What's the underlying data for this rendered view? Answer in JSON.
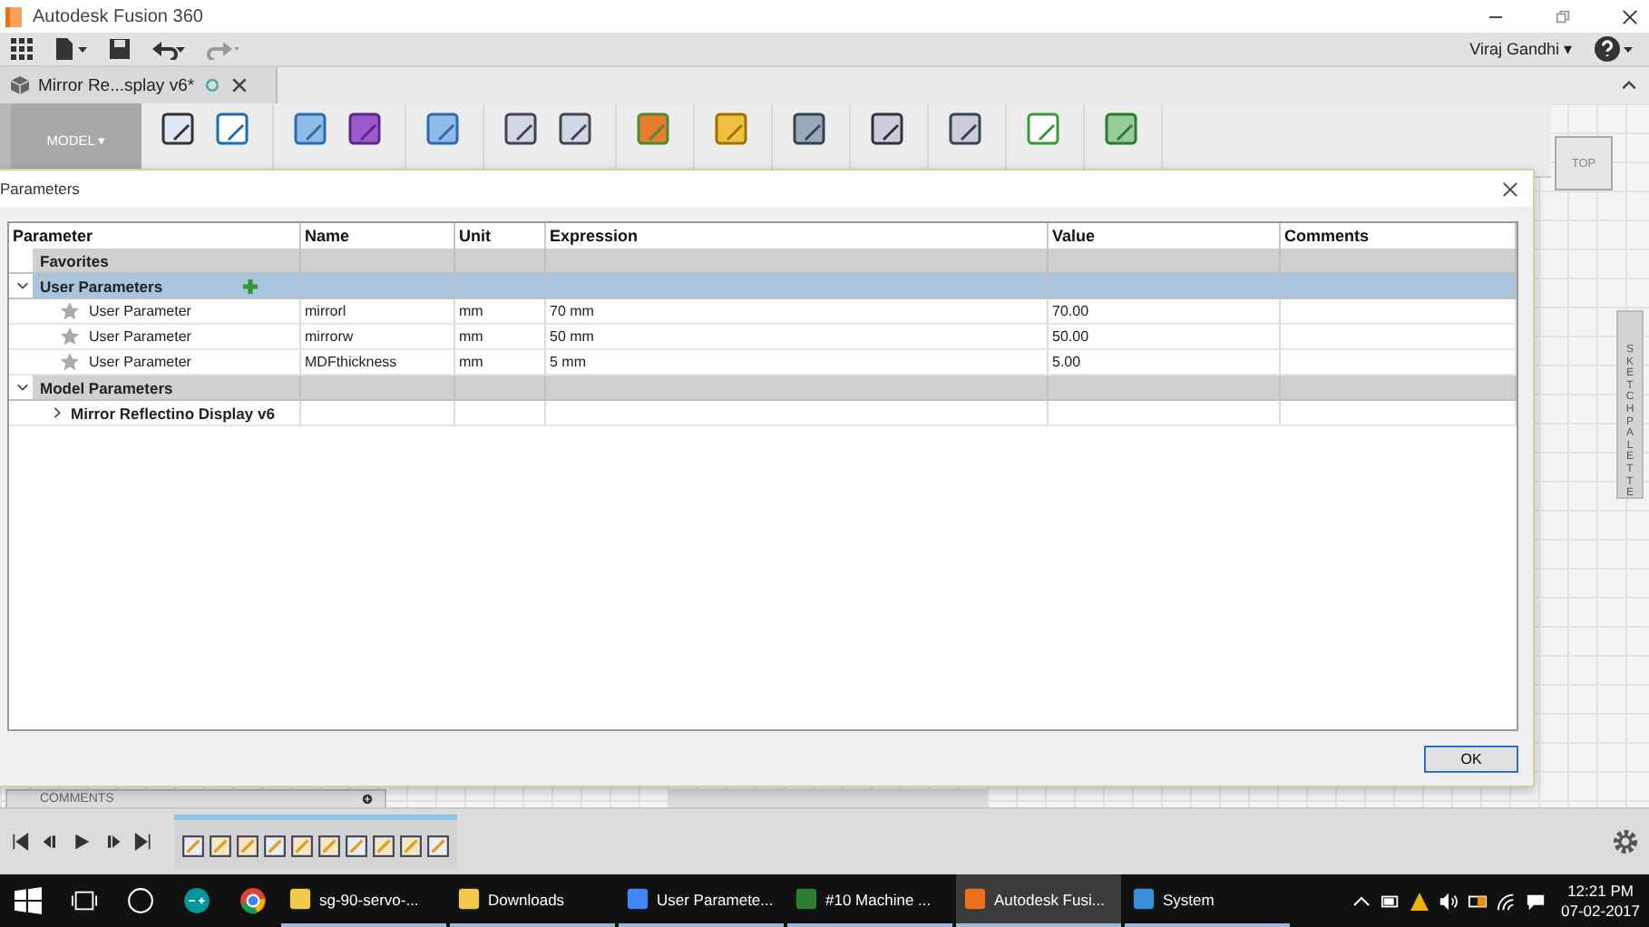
{
  "window": {
    "title": "Autodesk Fusion 360",
    "user": "Viraj Gandhi ▾"
  },
  "document_tab": {
    "label": "Mirror Re...splay v6*"
  },
  "ribbon": {
    "workspace": "MODEL ▾"
  },
  "viewcube": {
    "face": "TOP"
  },
  "sketch_palette": {
    "label": "SKETCH PALETTE"
  },
  "comments_panel": {
    "label": "COMMENTS"
  },
  "dialog": {
    "title": "Parameters",
    "columns": [
      "Parameter",
      "Name",
      "Unit",
      "Expression",
      "Value",
      "Comments"
    ],
    "rows": [
      {
        "kind": "group",
        "label": "Favorites",
        "selected": false
      },
      {
        "kind": "group",
        "label": "User Parameters",
        "expanded": true,
        "selected": true,
        "children": [
          {
            "kind": "param",
            "label": "User Parameter",
            "name": "mirrorl",
            "unit": "mm",
            "expression": "70 mm",
            "value": "70.00"
          },
          {
            "kind": "param",
            "label": "User Parameter",
            "name": "mirrorw",
            "unit": "mm",
            "expression": "50 mm",
            "value": "50.00"
          },
          {
            "kind": "param",
            "label": "User Parameter",
            "name": "MDFthickness",
            "unit": "mm",
            "expression": "5 mm",
            "value": "5.00"
          }
        ]
      },
      {
        "kind": "group",
        "label": "Model Parameters",
        "expanded": true,
        "selected": false,
        "children": [
          {
            "kind": "component",
            "label": "Mirror Reflectino Display v6",
            "expanded": false
          }
        ]
      }
    ],
    "ok_button": "OK"
  },
  "taskbar": {
    "apps": [
      {
        "label": "sg-90-servo-...",
        "selected": false
      },
      {
        "label": "Downloads",
        "selected": false
      },
      {
        "label": "User Paramete...",
        "selected": false
      },
      {
        "label": "#10 Machine ...",
        "selected": false
      },
      {
        "label": "Autodesk Fusi...",
        "selected": true
      },
      {
        "label": "System",
        "selected": false
      }
    ],
    "time": "12:21 PM",
    "date": "07-02-2017"
  }
}
